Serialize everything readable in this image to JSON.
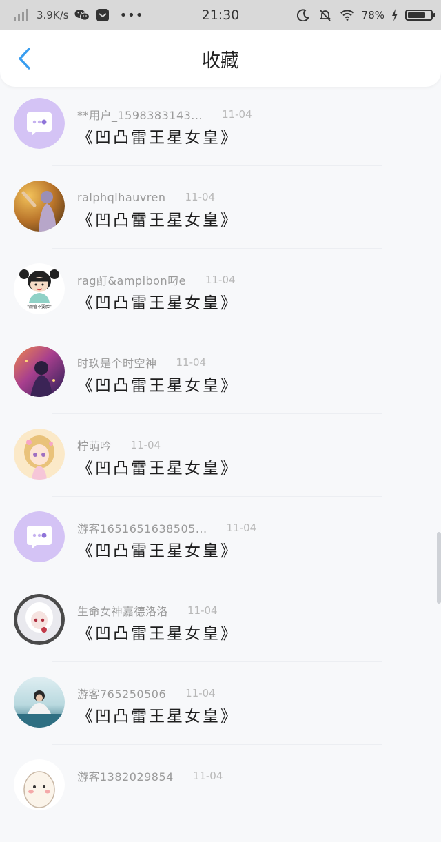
{
  "status_bar": {
    "net_speed": "3.9K/s",
    "time": "21:30",
    "battery": "78%",
    "battery_level": 0.78,
    "icons": [
      "signal-icon",
      "wechat-icon",
      "mail-icon",
      "more-dots-icon",
      "moon-icon",
      "mute-bell-icon",
      "wifi-icon",
      "battery-icon",
      "charging-icon"
    ],
    "dots": "•••"
  },
  "header": {
    "title": "收藏",
    "back_icon": "chevron-left-icon",
    "accent": "#3a9ef0"
  },
  "items": [
    {
      "user": "**用户_1598383143...",
      "date": "11-04",
      "title": "《凹凸雷王星女皇》",
      "avatar": "default-chat-bubble"
    },
    {
      "user": "ralphqlhauvren",
      "date": "11-04",
      "title": "《凹凸雷王星女皇》",
      "avatar": "photo-autumn-girl"
    },
    {
      "user": "rag酊&ampibon叼e",
      "date": "11-04",
      "title": "《凹凸雷王星女皇》",
      "avatar": "cartoon-girl",
      "avatar_caption": "\"颜值不要脸\""
    },
    {
      "user": "时玖是个时空神",
      "date": "11-04",
      "title": "《凹凸雷王星女皇》",
      "avatar": "anime-purple-art"
    },
    {
      "user": "柠萌吟",
      "date": "11-04",
      "title": "《凹凸雷王星女皇》",
      "avatar": "anime-blonde-girl"
    },
    {
      "user": "游客1651651638505...",
      "date": "11-04",
      "title": "《凹凸雷王星女皇》",
      "avatar": "default-chat-bubble"
    },
    {
      "user": "生命女神嘉德洛洛",
      "date": "11-04",
      "title": "《凹凸雷王星女皇》",
      "avatar": "anime-white-hair-girl"
    },
    {
      "user": "游客765250506",
      "date": "11-04",
      "title": "《凹凸雷王星女皇》",
      "avatar": "photo-water-girl"
    },
    {
      "user": "游客1382029854",
      "date": "11-04",
      "title": "",
      "avatar": "egg-character"
    }
  ],
  "colors": {
    "default_avatar": "#d4c3f5",
    "text_primary": "#1e1e1e",
    "text_secondary": "#9a9a9a"
  }
}
